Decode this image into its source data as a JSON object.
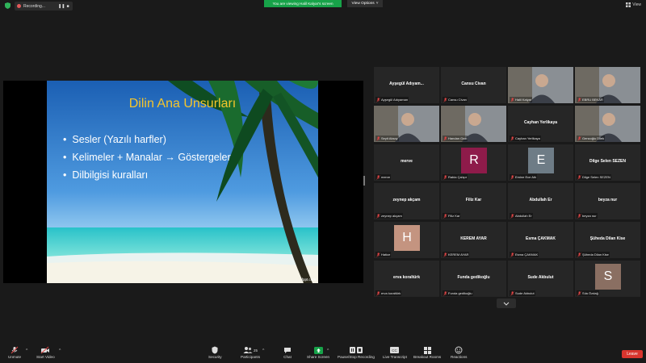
{
  "top": {
    "recording_text": "Recording...",
    "share_banner": "You are viewing Halil Kalyar's screen",
    "view_options": "View Options",
    "view_options_caret": "˅",
    "view_label": "View"
  },
  "slide": {
    "title": "Dilin Ana Unsurları",
    "bullets": [
      "Sesler (Yazılı harfler)",
      "Kelimeler + Manalar → Göstergeler",
      "Dilbilgisi kuralları"
    ],
    "credit": "fppt.com"
  },
  "participants": [
    {
      "name": "Ayşegül Adıyam...",
      "label": "Ayşegül Adıyaman",
      "kind": "name"
    },
    {
      "name": "Cansu Civan",
      "label": "Cansu Civan",
      "kind": "name"
    },
    {
      "name": "",
      "label": "Halil Kalyar",
      "kind": "video",
      "active": true
    },
    {
      "name": "",
      "label": "EBRU BEKAR",
      "kind": "video"
    },
    {
      "name": "",
      "label": "Seyit Aksoy",
      "kind": "video"
    },
    {
      "name": "",
      "label": "Handan Gazi",
      "kind": "video"
    },
    {
      "name": "Cayhan Yerlikaya",
      "label": "Cayhan Yerlikaya",
      "kind": "name"
    },
    {
      "name": "",
      "label": "Gencoğlu Dilek",
      "kind": "video"
    },
    {
      "name": "merve",
      "label": "merve",
      "kind": "name"
    },
    {
      "name": "",
      "label": "Rabia Çalışır",
      "kind": "initial",
      "initial": "R",
      "color": "#8e1b4a"
    },
    {
      "name": "",
      "label": "Emine Ece Atlı",
      "kind": "initial",
      "initial": "E",
      "color": "#6e7c86"
    },
    {
      "name": "Dilge Selen SEZEN",
      "label": "Dilge Selen SEZEN",
      "kind": "name"
    },
    {
      "name": "zeynep akçam",
      "label": "zeynep akçam",
      "kind": "name"
    },
    {
      "name": "Filiz Kar",
      "label": "Filiz Kar",
      "kind": "name"
    },
    {
      "name": "Abdullah Er",
      "label": "Abdullah Er",
      "kind": "name"
    },
    {
      "name": "beyza nur",
      "label": "beyza nur",
      "kind": "name"
    },
    {
      "name": "",
      "label": "Hatice",
      "kind": "initial",
      "initial": "H",
      "color": "#c49480"
    },
    {
      "name": "KEREM AYAR",
      "label": "KEREM AYAR",
      "kind": "name"
    },
    {
      "name": "Esma ÇAKMAK",
      "label": "Esma ÇAKMAK",
      "kind": "name"
    },
    {
      "name": "Şüheda Dilan Kise",
      "label": "Şüheda Dilan Kise",
      "kind": "name"
    },
    {
      "name": "erva koraltürk",
      "label": "erva koraltürk",
      "kind": "name"
    },
    {
      "name": "Funda gedikoğlu",
      "label": "Funda gedikoğlu",
      "kind": "name"
    },
    {
      "name": "Sude Akbulut",
      "label": "Sude Akbulut",
      "kind": "name"
    },
    {
      "name": "",
      "label": "Sıla Özdağ",
      "kind": "initial",
      "initial": "S",
      "color": "#8a6f62"
    }
  ],
  "toolbar": {
    "unmute": "Unmute",
    "start_video": "Start Video",
    "security": "Security",
    "participants": "Participants",
    "participants_count": "25",
    "chat": "Chat",
    "share_screen": "Share Screen",
    "pause_recording": "Pause/Stop Recording",
    "live_transcript": "Live Transcript",
    "breakout_rooms": "Breakout Rooms",
    "reactions": "Reactions",
    "leave": "Leave",
    "caret": "^",
    "cc": "CC"
  },
  "colors": {
    "accent_green": "#17a349",
    "leave_red": "#d9352e",
    "slide_title": "#f5c52b",
    "active_speaker": "#b7d96b"
  }
}
